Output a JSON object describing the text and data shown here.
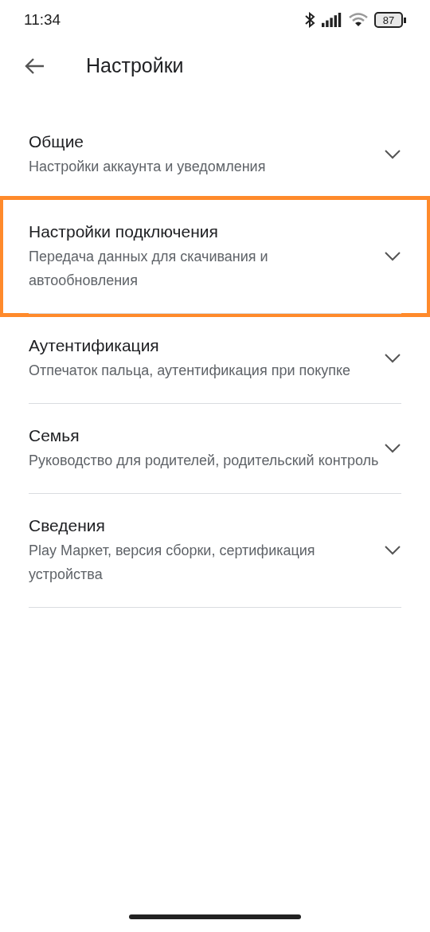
{
  "status_bar": {
    "time": "11:34",
    "battery": "87"
  },
  "header": {
    "title": "Настройки"
  },
  "sections": [
    {
      "title": "Общие",
      "subtitle": "Настройки аккаунта и уведомления",
      "expanded": false,
      "highlighted": false
    },
    {
      "title": "Настройки подключения",
      "subtitle": "Передача данных для скачивания и автообновления",
      "expanded": false,
      "highlighted": true
    },
    {
      "title": "Аутентификация",
      "subtitle": "Отпечаток пальца, аутентификация при покупке",
      "expanded": false,
      "highlighted": false
    },
    {
      "title": "Семья",
      "subtitle": "Руководство для родителей, родительский контроль",
      "expanded": false,
      "highlighted": false
    },
    {
      "title": "Сведения",
      "subtitle": "Play Маркет, версия сборки, сертификация устройства",
      "expanded": false,
      "highlighted": false
    }
  ]
}
